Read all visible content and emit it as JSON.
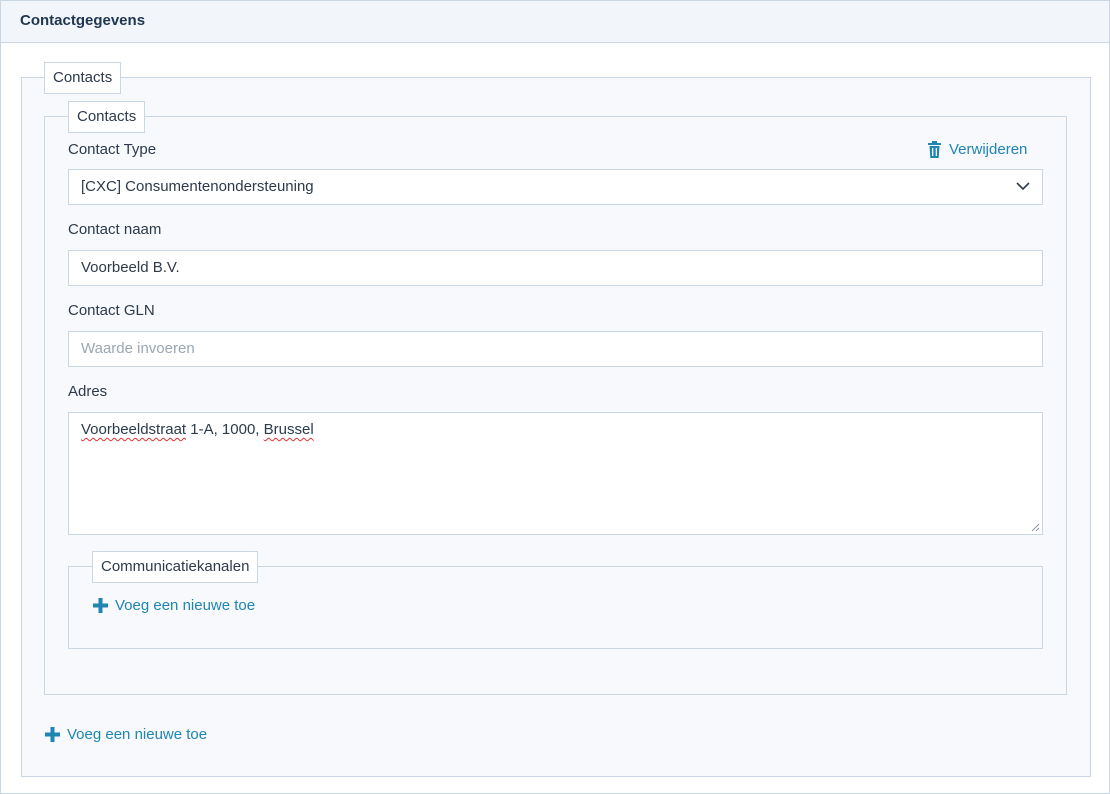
{
  "panel": {
    "title": "Contactgegevens"
  },
  "outer": {
    "legend": "Contacts",
    "add_label": "Voeg een nieuwe toe"
  },
  "contact": {
    "legend": "Contacts",
    "delete_label": "Verwijderen",
    "type_label": "Contact Type",
    "type_value": "[CXC] Consumentenondersteuning",
    "name_label": "Contact naam",
    "name_value": "Voorbeeld B.V.",
    "gln_label": "Contact GLN",
    "gln_placeholder": "Waarde invoeren",
    "address_label": "Adres",
    "address_parts": [
      "Voorbeeldstraat",
      " 1-A, 1000, ",
      "Brussel"
    ]
  },
  "channels": {
    "legend": "Communicatiekanalen",
    "add_label": "Voeg een nieuwe toe"
  },
  "colors": {
    "accent": "#1f85b3",
    "border": "#c9d6e3",
    "header_bg": "#f2f6fa",
    "spellcheck": "#e03030"
  }
}
